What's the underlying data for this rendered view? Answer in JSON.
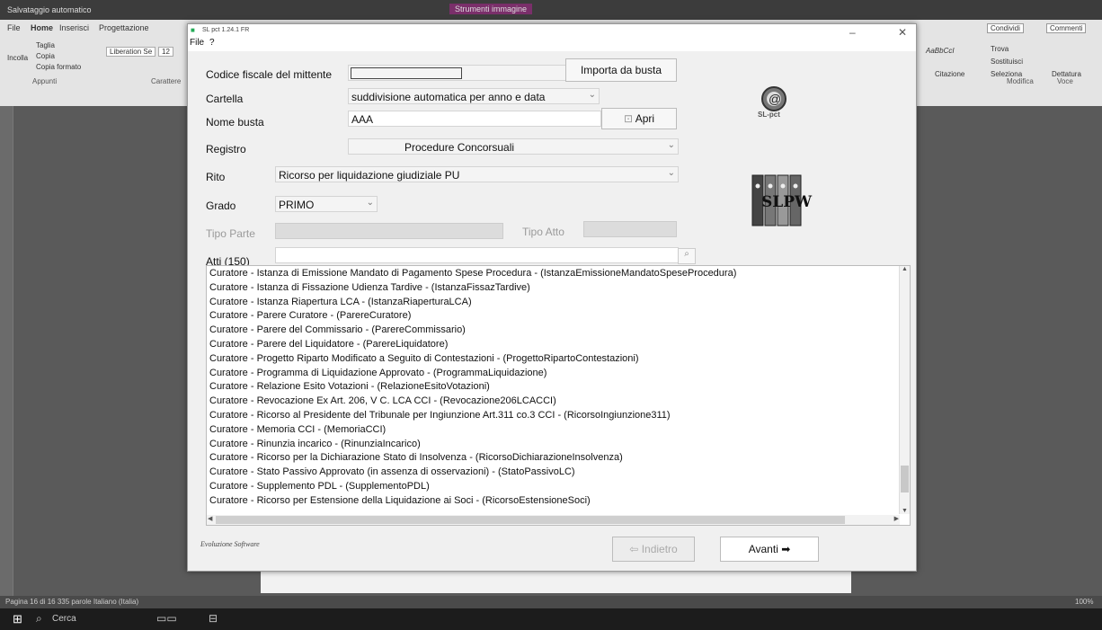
{
  "word": {
    "title": "Salvataggio automatico",
    "title_center": "Strumenti immagine",
    "tabs": [
      "File",
      "Home",
      "Inserisci",
      "Progettazione"
    ],
    "share": "Condividi",
    "comments": "Commenti",
    "ribbon_buttons": [
      "Taglia",
      "Copia",
      "Copia formato",
      "Incolla"
    ],
    "font_name": "Liberation Se",
    "font_size": "12",
    "groups": [
      "Appunti",
      "Carattere",
      "Modifica",
      "Voce"
    ],
    "style_preview": "AaBbCcI",
    "style_label": "Citazione",
    "find": "Trova",
    "replace": "Sostituisci",
    "select": "Seleziona",
    "dictate": "Dettatura",
    "status": "Pagina 16 di 16   335 parole   Italiano (Italia)",
    "zoom": "100%"
  },
  "taskbar": {
    "search_placeholder": "Cerca"
  },
  "dialog": {
    "title": "SL pct 1.24.1 FR",
    "menu": [
      "File",
      "?"
    ],
    "codice_fiscale_label": "Codice fiscale del mittente",
    "codice_fiscale_value": "",
    "importa_button": "Importa da busta",
    "cartella_label": "Cartella",
    "cartella_value": "suddivisione automatica per anno e data",
    "nome_busta_label": "Nome busta",
    "nome_busta_value": "AAA",
    "apri_button": "Apri",
    "registro_label": "Registro",
    "registro_value": "Procedure Concorsuali",
    "rito_label": "Rito",
    "rito_value": "Ricorso per liquidazione giudiziale PU",
    "grado_label": "Grado",
    "grado_value": "PRIMO",
    "tipo_parte_label": "Tipo Parte",
    "tipo_atto_label": "Tipo Atto",
    "atti_label": "Atti (150)",
    "logo_pct_text": "SL-pct",
    "logo_pw_text": "SLPW",
    "footer_brand": "Evoluzione Software",
    "indietro_button": "Indietro",
    "avanti_button": "Avanti",
    "atti": [
      "Curatore - Istanza di Emissione Mandato di Pagamento Spese Procedura - (IstanzaEmissioneMandatoSpeseProcedura)",
      "Curatore - Istanza di Fissazione Udienza Tardive - (IstanzaFissazTardive)",
      "Curatore - Istanza Riapertura LCA - (IstanzaRiaperturaLCA)",
      "Curatore - Parere Curatore - (ParereCuratore)",
      "Curatore - Parere del Commissario - (ParereCommissario)",
      "Curatore - Parere del Liquidatore - (ParereLiquidatore)",
      "Curatore - Progetto Riparto Modificato a Seguito di Contestazioni - (ProgettoRipartoContestazioni)",
      "Curatore - Programma di Liquidazione Approvato - (ProgrammaLiquidazione)",
      "Curatore - Relazione Esito Votazioni - (RelazioneEsitoVotazioni)",
      "Curatore - Revocazione Ex Art. 206, V C. LCA CCI - (Revocazione206LCACCI)",
      "Curatore - Ricorso al Presidente del Tribunale per Ingiunzione Art.311 co.3 CCI - (RicorsoIngiunzione311)",
      "Curatore - Memoria CCI - (MemoriaCCI)",
      "Curatore - Rinunzia incarico - (RinunziaIncarico)",
      "Curatore - Ricorso per la Dichiarazione Stato di Insolvenza - (RicorsoDichiarazioneInsolvenza)",
      "Curatore - Stato Passivo Approvato (in assenza di osservazioni) - (StatoPassivoLC)",
      "Curatore - Supplemento PDL - (SupplementoPDL)",
      "Curatore - Ricorso per Estensione della Liquidazione ai Soci - (RicorsoEstensioneSoci)"
    ]
  }
}
